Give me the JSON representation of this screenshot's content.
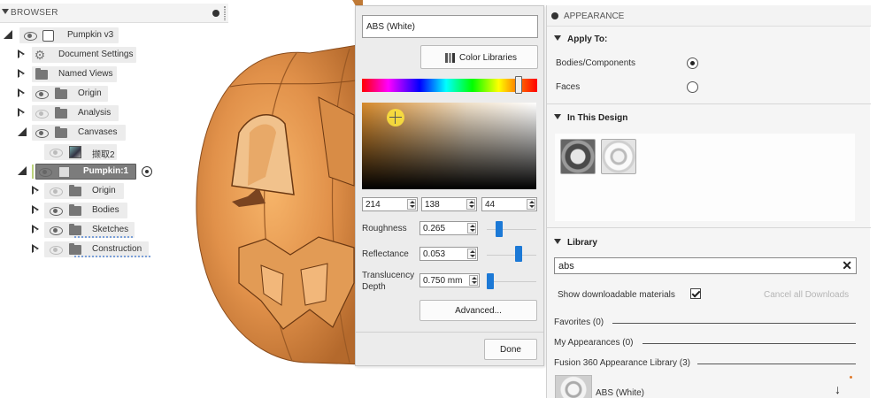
{
  "browser": {
    "title": "BROWSER",
    "items": [
      {
        "label": "Pumpkin v3"
      },
      {
        "label": "Document Settings"
      },
      {
        "label": "Named Views"
      },
      {
        "label": "Origin"
      },
      {
        "label": "Analysis"
      },
      {
        "label": "Canvases"
      },
      {
        "label": "撷取2"
      },
      {
        "label": "Pumpkin:1"
      },
      {
        "label": "Origin"
      },
      {
        "label": "Bodies"
      },
      {
        "label": "Sketches"
      },
      {
        "label": "Construction"
      }
    ]
  },
  "color_picker": {
    "material_name": "ABS (White)",
    "color_libraries_label": "Color Libraries",
    "rgb": {
      "r": "214",
      "g": "138",
      "b": "44"
    },
    "roughness_label": "Roughness",
    "roughness_value": "0.265",
    "reflectance_label": "Reflectance",
    "reflectance_value": "0.053",
    "translucency_label_1": "Translucency",
    "translucency_label_2": "Depth",
    "translucency_value": "0.750 mm",
    "advanced_label": "Advanced...",
    "done_label": "Done",
    "accent_color": "#1c79d6",
    "selected_color": "#d68a2c"
  },
  "appearance": {
    "title": "APPEARANCE",
    "apply_to": {
      "title": "Apply To:",
      "options": [
        {
          "label": "Bodies/Components",
          "selected": true
        },
        {
          "label": "Faces",
          "selected": false
        }
      ]
    },
    "in_this_design": {
      "title": "In This Design"
    },
    "library": {
      "title": "Library",
      "search_value": "abs",
      "show_downloadable_label": "Show downloadable materials",
      "cancel_downloads_label": "Cancel all Downloads",
      "categories": [
        {
          "label": "Favorites (0)"
        },
        {
          "label": "My Appearances (0)"
        },
        {
          "label": "Fusion 360 Appearance Library (3)"
        }
      ],
      "result_item": "ABS (White)"
    }
  }
}
